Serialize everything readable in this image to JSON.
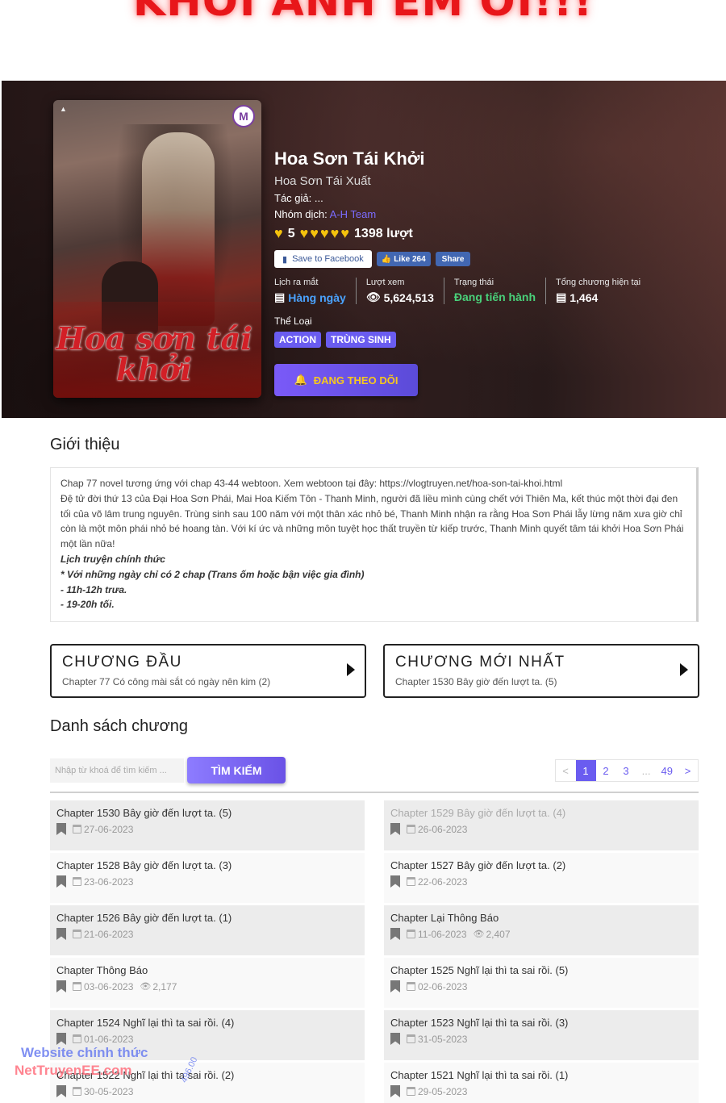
{
  "banner": {
    "text": "KHỞI ANH EM ƠI!!!"
  },
  "manga": {
    "title": "Hoa Sơn Tái Khởi",
    "alt_title": "Hoa Sơn Tái Xuất",
    "author_label": "Tác giả:",
    "author": "...",
    "group_label": "Nhóm dịch:",
    "group": "A-H Team",
    "rating_score": "5",
    "rating_count": "1398 lượt",
    "cover_title": "Hoa sơn tái khởi",
    "save_facebook": "Save to Facebook",
    "fb_like": "Like 264",
    "fb_share": "Share",
    "stats": [
      {
        "label": "Lịch ra mắt",
        "value": "Hàng ngày",
        "icon": "newspaper-icon"
      },
      {
        "label": "Lượt xem",
        "value": "5,624,513",
        "icon": "eye-icon"
      },
      {
        "label": "Trạng thái",
        "value": "Đang tiến hành",
        "icon": ""
      },
      {
        "label": "Tổng chương hiện tại",
        "value": "1,464",
        "icon": "list-icon"
      }
    ],
    "genres_label": "Thể Loại",
    "genres": [
      "ACTION",
      "TRÙNG SINH"
    ],
    "follow_button": "ĐANG THEO DÕI"
  },
  "intro": {
    "title": "Giới thiệu",
    "lines": [
      "Chap 77 novel tương ứng với chap 43-44 webtoon. Xem webtoon tại đây: https://vlogtruyen.net/hoa-son-tai-khoi.html",
      "Đệ tử đời thứ 13 của Đại Hoa Sơn Phái, Mai Hoa Kiếm Tôn - Thanh Minh, người đã liều mình cùng chết với Thiên Ma, kết thúc một thời đại đen tối của võ lâm trung nguyên. Trùng sinh sau 100 năm với một thân xác nhỏ bé, Thanh Minh nhận ra rằng Hoa Sơn Phái lẫy lừng năm xưa giờ chỉ còn là một môn phái nhỏ bé hoang tàn. Với kí ức và những môn tuyệt học thất truyền từ kiếp trước, Thanh Minh quyết tâm tái khởi Hoa Sơn Phái một lần nữa!"
    ],
    "schedule_lines": [
      "Lịch truyện chính thức",
      "* Với những ngày chỉ có 2 chap (Trans ốm hoặc bận việc gia đình)",
      "- 11h-12h trưa.",
      "- 19-20h tối."
    ]
  },
  "first_chapter": {
    "title": "CHƯƠNG ĐẦU",
    "subtitle": "Chapter 77 Có công mài sắt có ngày nên kim (2)"
  },
  "latest_chapter": {
    "title": "CHƯƠNG MỚI NHẤT",
    "subtitle": "Chapter 1530 Bây giờ đến lượt ta. (5)"
  },
  "chapter_list": {
    "title": "Danh sách chương",
    "search_placeholder": "Nhập từ khoá để tìm kiếm ...",
    "search_button": "TÌM KIẾM",
    "pagination": [
      "<",
      "1",
      "2",
      "3",
      "...",
      "49",
      ">"
    ],
    "current_page": "1",
    "chapters": [
      {
        "name": "Chapter 1530 Bây giờ đến lượt ta. (5)",
        "date": "27-06-2023",
        "views": ""
      },
      {
        "name": "Chapter 1529 Bây giờ đến lượt ta. (4)",
        "date": "26-06-2023",
        "views": "",
        "read": true
      },
      {
        "name": "Chapter 1528 Bây giờ đến lượt ta. (3)",
        "date": "23-06-2023",
        "views": ""
      },
      {
        "name": "Chapter 1527 Bây giờ đến lượt ta. (2)",
        "date": "22-06-2023",
        "views": ""
      },
      {
        "name": "Chapter 1526 Bây giờ đến lượt ta. (1)",
        "date": "21-06-2023",
        "views": ""
      },
      {
        "name": "Chapter Lại Thông Báo",
        "date": "11-06-2023",
        "views": "2,407"
      },
      {
        "name": "Chapter Thông Báo",
        "date": "03-06-2023",
        "views": "2,177"
      },
      {
        "name": "Chapter 1525 Nghĩ lại thì ta sai rồi. (5)",
        "date": "02-06-2023",
        "views": ""
      },
      {
        "name": "Chapter 1524 Nghĩ lại thì ta sai rồi. (4)",
        "date": "01-06-2023",
        "views": ""
      },
      {
        "name": "Chapter 1523 Nghĩ lại thì ta sai rồi. (3)",
        "date": "31-05-2023",
        "views": ""
      },
      {
        "name": "Chapter 1522 Nghĩ lại thì ta sai rồi. (2)",
        "date": "30-05-2023",
        "views": ""
      },
      {
        "name": "Chapter 1521 Nghĩ lại thì ta sai rồi. (1)",
        "date": "29-05-2023",
        "views": ""
      }
    ]
  },
  "watermark": {
    "line1": "Website chính thức",
    "line2": "NetTruyenEE.com",
    "number": "496.00"
  }
}
